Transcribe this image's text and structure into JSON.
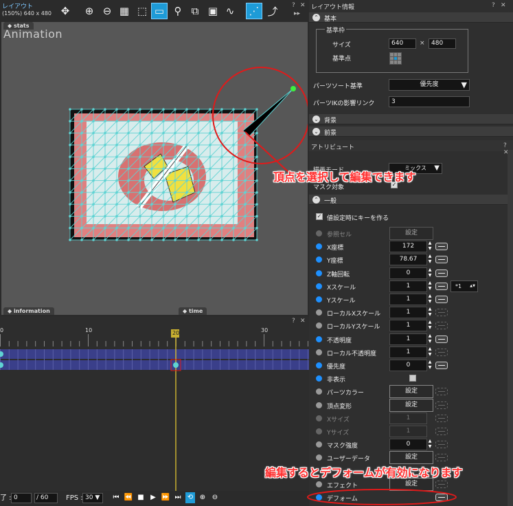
{
  "layout_panel": {
    "title": "レイアウト",
    "subtitle": "(150%) 640 x 480"
  },
  "viewport": {
    "stats_tab": "stats",
    "watermark": "Animation",
    "information_tab": "information",
    "time_tab": "time"
  },
  "timeline": {
    "help": "?",
    "close": "✕",
    "ticks": [
      "0",
      "10",
      "20",
      "30"
    ],
    "current_frame_marker": "20",
    "frame_label": "了 :",
    "frame_value": "0",
    "total_frames": "/ 60",
    "fps_label": "FPS :",
    "fps_value": "30"
  },
  "layout_info": {
    "title": "レイアウト情報",
    "section_basic": "基本",
    "frame_group": "基準枠",
    "size_label": "サイズ",
    "size_w": "640",
    "size_x": "×",
    "size_h": "480",
    "origin_label": "基準点",
    "sort_label": "パーツソート基準",
    "sort_value": "優先度",
    "ik_label": "パーツIKの影響リンク",
    "ik_value": "3",
    "section_bg": "背景",
    "section_fg": "前景"
  },
  "attribute": {
    "title": "アトリビュート",
    "blend_label": "描画モード",
    "blend_value": "ミックス",
    "mask_target_label": "マスク対象",
    "section_general": "一般",
    "key_on_set_label": "値設定時にキーを作る",
    "rows": [
      {
        "label": "参照セル",
        "kind": "set",
        "value": "設定",
        "dot": "dg"
      },
      {
        "label": "X座標",
        "kind": "num",
        "value": "172",
        "dot": "b"
      },
      {
        "label": "Y座標",
        "kind": "num",
        "value": "78.67",
        "dot": "b"
      },
      {
        "label": "Z軸回転",
        "kind": "num",
        "value": "0",
        "dot": "b"
      },
      {
        "label": "Xスケール",
        "kind": "num",
        "value": "1",
        "dot": "b",
        "extra": "*1"
      },
      {
        "label": "Yスケール",
        "kind": "num",
        "value": "1",
        "dot": "b"
      },
      {
        "label": "ローカルXスケール",
        "kind": "num",
        "value": "1",
        "dot": "g"
      },
      {
        "label": "ローカルYスケール",
        "kind": "num",
        "value": "1",
        "dot": "g"
      },
      {
        "label": "不透明度",
        "kind": "num",
        "value": "1",
        "dot": "b"
      },
      {
        "label": "ローカル不透明度",
        "kind": "num",
        "value": "1",
        "dot": "g"
      },
      {
        "label": "優先度",
        "kind": "num",
        "value": "0",
        "dot": "b"
      },
      {
        "label": "非表示",
        "kind": "check",
        "value": "",
        "dot": "b"
      },
      {
        "label": "パーツカラー",
        "kind": "set",
        "value": "設定",
        "dot": "g"
      },
      {
        "label": "頂点変形",
        "kind": "set",
        "value": "設定",
        "dot": "g"
      },
      {
        "label": "Xサイズ",
        "kind": "numdim",
        "value": "1",
        "dot": "dg"
      },
      {
        "label": "Yサイズ",
        "kind": "numdim",
        "value": "1",
        "dot": "dg"
      },
      {
        "label": "マスク強度",
        "kind": "num",
        "value": "0",
        "dot": "g"
      },
      {
        "label": "ユーザーデータ",
        "kind": "set",
        "value": "設定",
        "dot": "g"
      },
      {
        "label": "",
        "kind": "blank",
        "value": "",
        "dot": ""
      },
      {
        "label": "エフェクト",
        "kind": "set",
        "value": "設定",
        "dot": "g"
      },
      {
        "label": "デフォーム",
        "kind": "link",
        "value": "",
        "dot": "b"
      }
    ]
  },
  "annotations": {
    "vertex_note": "頂点を選択して編集できます",
    "deform_note": "編集するとデフォームが有効になります"
  },
  "colors": {
    "accent": "#1e9bd7",
    "annotation_red": "#ff2020",
    "mesh": "#5fd3d3"
  }
}
